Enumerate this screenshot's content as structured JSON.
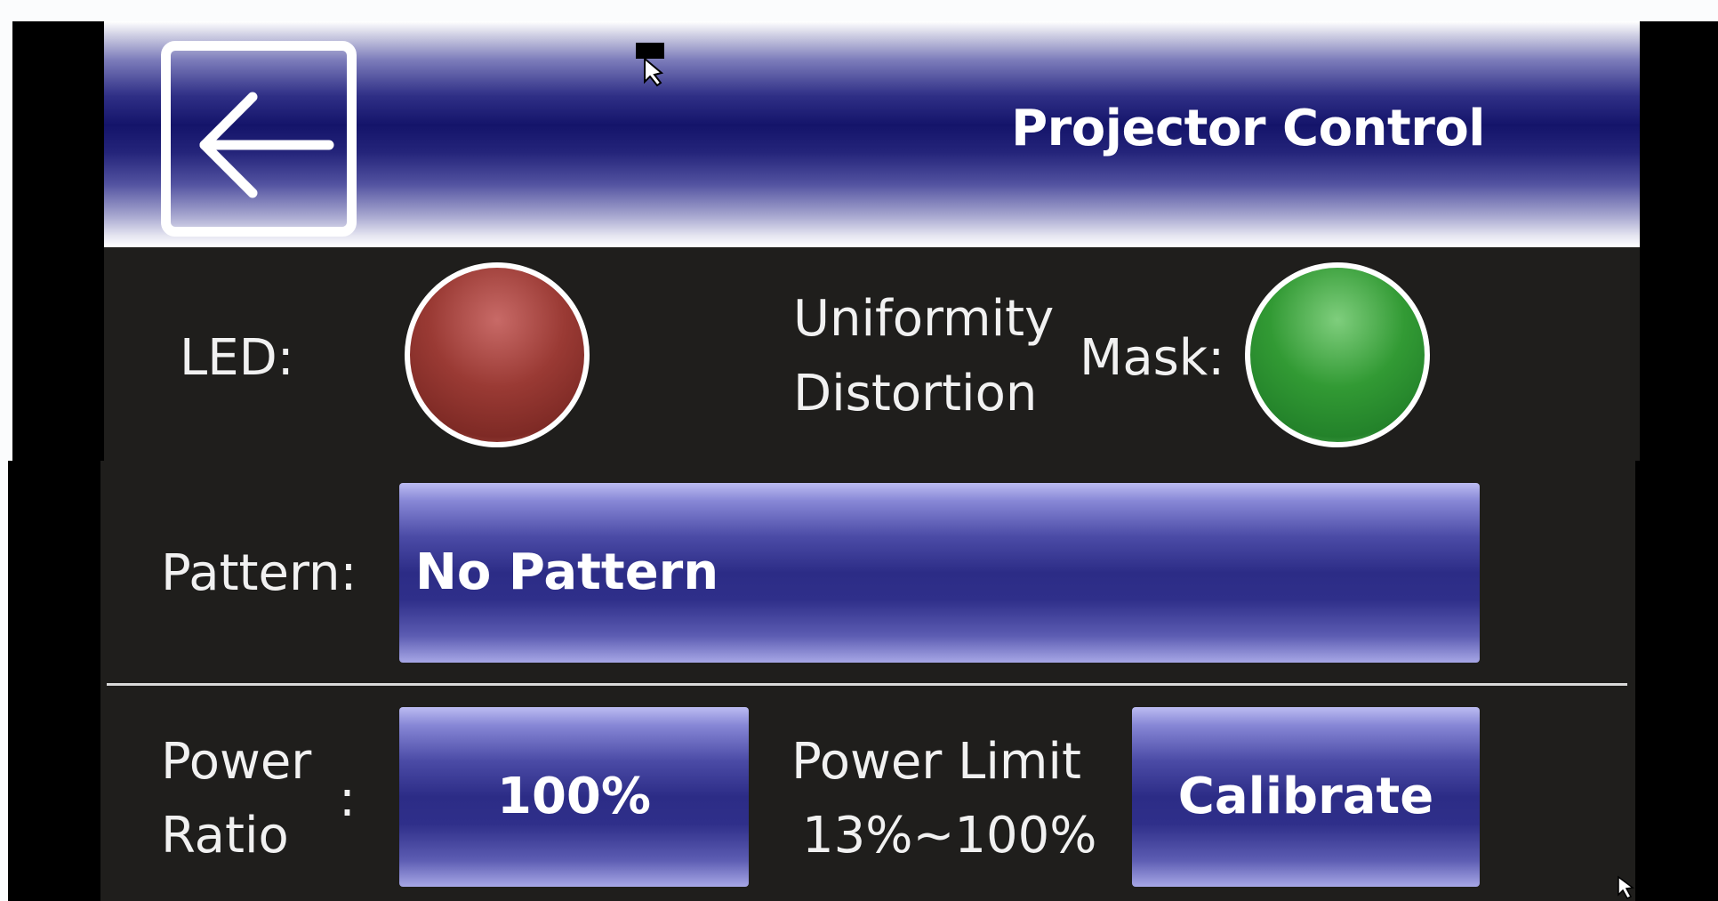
{
  "header": {
    "title": "Projector Control",
    "back_icon": "arrow-left-icon"
  },
  "status": {
    "led_label": "LED:",
    "led_state_color": "#9a3a34",
    "mode_line1": "Uniformity",
    "mode_line2": "Distortion",
    "mask_label": "Mask:",
    "mask_state_color": "#329a34"
  },
  "pattern": {
    "label": "Pattern:",
    "value": "No Pattern"
  },
  "power": {
    "ratio_label_line1": "Power",
    "ratio_label_line2": "Ratio",
    "ratio_colon": ":",
    "ratio_value": "100%",
    "limit_label": "Power Limit",
    "limit_range": "13%~100%",
    "calibrate_label": "Calibrate"
  },
  "colors": {
    "accent_blue": "#2c2c86",
    "panel_background": "#1f1e1c",
    "text": "#f1f1f1"
  }
}
